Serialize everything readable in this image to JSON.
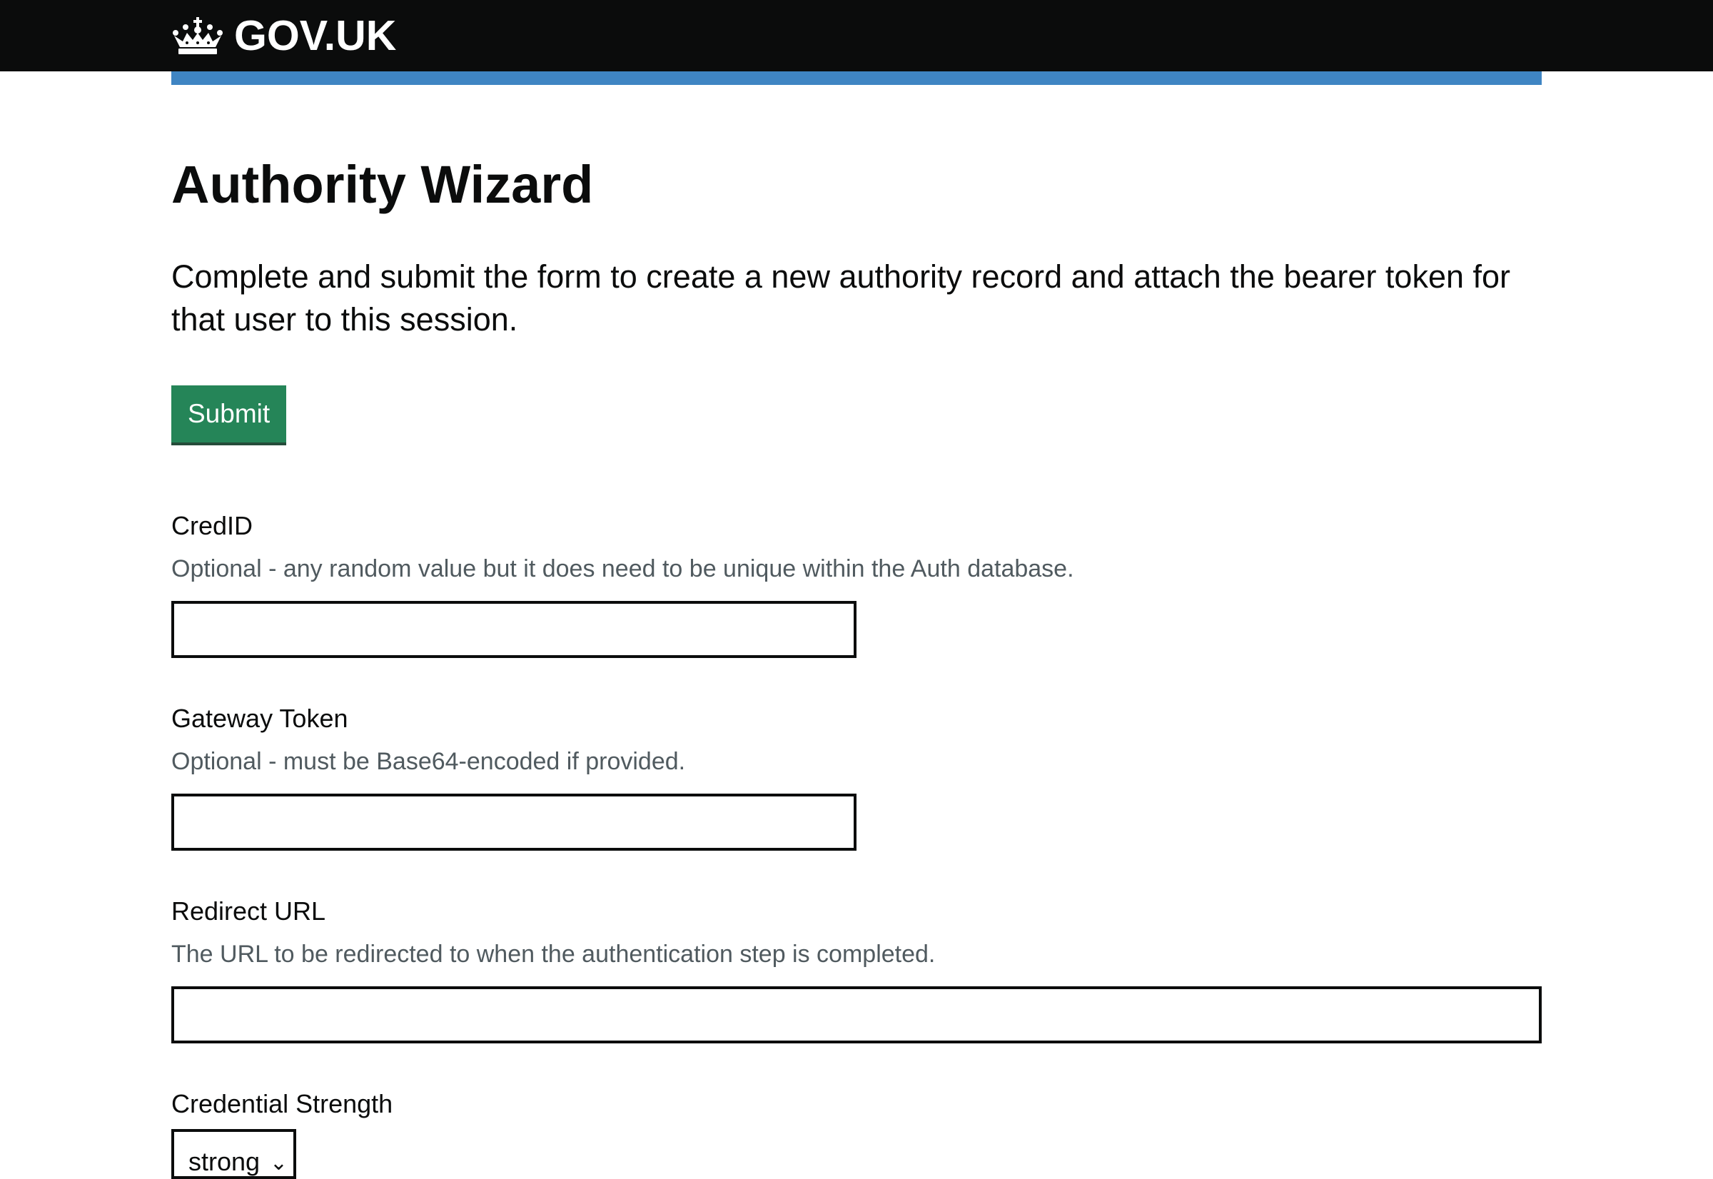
{
  "header": {
    "logo_text": "GOV.UK"
  },
  "page": {
    "title": "Authority Wizard",
    "lead": "Complete and submit the form to create a new authority record and attach the bearer token for that user to this session.",
    "submit_label": "Submit"
  },
  "form": {
    "cred_id": {
      "label": "CredID",
      "hint": "Optional - any random value but it does need to be unique within the Auth database.",
      "value": ""
    },
    "gateway_token": {
      "label": "Gateway Token",
      "hint": "Optional - must be Base64-encoded if provided.",
      "value": ""
    },
    "redirect_url": {
      "label": "Redirect URL",
      "hint": "The URL to be redirected to when the authentication step is completed.",
      "value": ""
    },
    "credential_strength": {
      "label": "Credential Strength",
      "selected": "strong"
    }
  },
  "colors": {
    "header_bg": "#0b0c0c",
    "header_accent": "#1d70b8",
    "button": "#00703c",
    "hint_text": "#505a5f"
  },
  "icons": {
    "logo": "crown-icon",
    "select": "chevron-down-icon"
  }
}
